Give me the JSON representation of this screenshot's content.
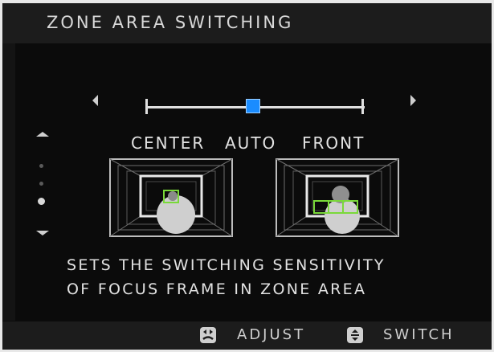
{
  "header": {
    "title": "ZONE AREA SWITCHING"
  },
  "slider": {
    "selected_index": 1,
    "position_count": 3
  },
  "modes": {
    "center": "CENTER",
    "auto": "AUTO",
    "front": "FRONT"
  },
  "description": {
    "line1": "SETS THE SWITCHING SENSITIVITY",
    "line2": "OF FOCUS FRAME IN ZONE AREA"
  },
  "footer": {
    "adjust_label": "ADJUST",
    "switch_label": "SWITCH"
  },
  "page_indicator": {
    "total": 3,
    "current": 3
  },
  "icons": {
    "left": "triangle-left-icon",
    "right": "triangle-right-icon",
    "up": "triangle-up-icon",
    "down": "triangle-down-icon",
    "adjust": "rear-command-dial-icon",
    "switch": "front-command-dial-icon"
  },
  "colors": {
    "accent": "#1a8cff",
    "focus_frame": "#7ad93a",
    "background": "#0b0b0b",
    "bar": "#1c1c1c"
  }
}
